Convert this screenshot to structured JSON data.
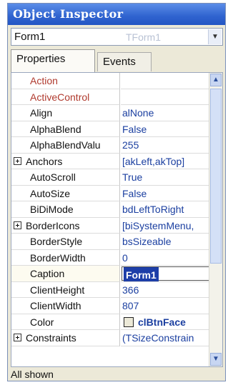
{
  "window": {
    "title": "Object Inspector"
  },
  "selector": {
    "name": "Form1",
    "type": "TForm1",
    "dropdown_icon": "chevron-down-icon"
  },
  "tabs": [
    {
      "label": "Properties",
      "active": true
    },
    {
      "label": "Events",
      "active": false
    }
  ],
  "properties": [
    {
      "name": "Action",
      "value": "",
      "kind": "event"
    },
    {
      "name": "ActiveControl",
      "value": "",
      "kind": "event"
    },
    {
      "name": "Align",
      "value": "alNone"
    },
    {
      "name": "AlphaBlend",
      "value": "False"
    },
    {
      "name": "AlphaBlendValu",
      "value": "255"
    },
    {
      "name": "Anchors",
      "value": "[akLeft,akTop]",
      "expandable": true
    },
    {
      "name": "AutoScroll",
      "value": "True"
    },
    {
      "name": "AutoSize",
      "value": "False"
    },
    {
      "name": "BiDiMode",
      "value": "bdLeftToRight"
    },
    {
      "name": "BorderIcons",
      "value": "[biSystemMenu,",
      "expandable": true
    },
    {
      "name": "BorderStyle",
      "value": "bsSizeable"
    },
    {
      "name": "BorderWidth",
      "value": "0"
    },
    {
      "name": "Caption",
      "value": "Form1",
      "selected": true
    },
    {
      "name": "ClientHeight",
      "value": "366"
    },
    {
      "name": "ClientWidth",
      "value": "807"
    },
    {
      "name": "Color",
      "value": "clBtnFace",
      "swatch": "#ece9d8"
    },
    {
      "name": "Constraints",
      "value": "(TSizeConstrain",
      "expandable": true
    }
  ],
  "status": {
    "text": "All shown"
  },
  "colors": {
    "title_bar": "#2f63cf",
    "value_text": "#1b3fa0",
    "event_text": "#b03a2e",
    "selection": "#1d3ea8"
  }
}
